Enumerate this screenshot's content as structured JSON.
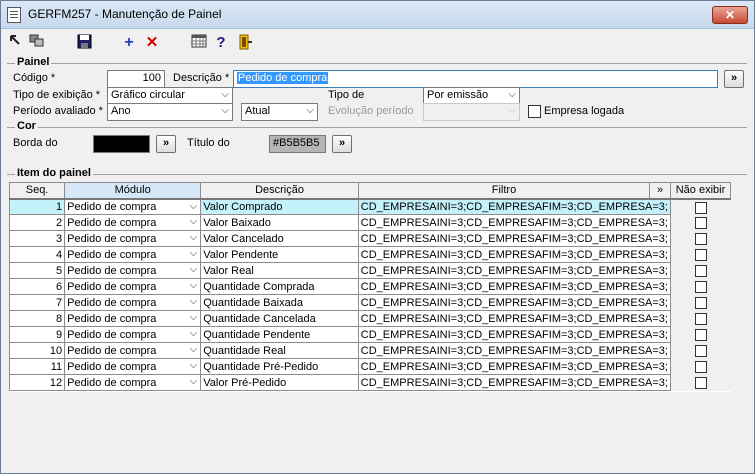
{
  "window": {
    "title": "GERFM257 - Manutenção de Painel",
    "close_glyph": "✕"
  },
  "toolbar": {
    "icons": [
      "expand-icon",
      "windows-icon",
      "save-icon",
      "add-icon",
      "delete-icon",
      "calendar-icon",
      "help-icon",
      "exit-icon"
    ],
    "add_glyph": "+",
    "delete_glyph": "✕",
    "help_glyph": "?"
  },
  "painel": {
    "group_title": "Painel",
    "codigo_label": "Código *",
    "codigo_value": "100",
    "descricao_label": "Descrição *",
    "descricao_value": "Pedido de compra",
    "descricao_button": "»",
    "tipo_exibicao_label": "Tipo de exibição *",
    "tipo_exibicao_value": "Gráfico circular",
    "tipo_de_label": "Tipo de",
    "tipo_de_value": "Por emissão",
    "periodo_label": "Período avaliado *",
    "periodo_value": "Ano",
    "atual_value": "Atual",
    "evolucao_label": "Evolução período",
    "evolucao_value": "",
    "empresa_logada_label": "Empresa logada"
  },
  "cor": {
    "group_title": "Cor",
    "borda_label": "Borda do",
    "borda_color": "#000000",
    "borda_button": "»",
    "titulo_label": "Título do",
    "titulo_value": "#B5B5B5",
    "titulo_button": "»"
  },
  "itens": {
    "group_title": "Item do painel",
    "headers": {
      "seq": "Seq.",
      "modulo": "Módulo",
      "descricao": "Descrição",
      "filtro": "Filtro",
      "more": "»",
      "nao_exibir": "Não exibir"
    },
    "rows": [
      {
        "seq": "1",
        "modulo": "Pedido de compra",
        "descricao": "Valor Comprado",
        "filtro": "CD_EMPRESAINI=3;CD_EMPRESAFIM=3;CD_EMPRESA=3;"
      },
      {
        "seq": "2",
        "modulo": "Pedido de compra",
        "descricao": "Valor Baixado",
        "filtro": "CD_EMPRESAINI=3;CD_EMPRESAFIM=3;CD_EMPRESA=3;"
      },
      {
        "seq": "3",
        "modulo": "Pedido de compra",
        "descricao": "Valor Cancelado",
        "filtro": "CD_EMPRESAINI=3;CD_EMPRESAFIM=3;CD_EMPRESA=3;"
      },
      {
        "seq": "4",
        "modulo": "Pedido de compra",
        "descricao": "Valor Pendente",
        "filtro": "CD_EMPRESAINI=3;CD_EMPRESAFIM=3;CD_EMPRESA=3;"
      },
      {
        "seq": "5",
        "modulo": "Pedido de compra",
        "descricao": "Valor Real",
        "filtro": "CD_EMPRESAINI=3;CD_EMPRESAFIM=3;CD_EMPRESA=3;"
      },
      {
        "seq": "6",
        "modulo": "Pedido de compra",
        "descricao": "Quantidade Comprada",
        "filtro": "CD_EMPRESAINI=3;CD_EMPRESAFIM=3;CD_EMPRESA=3;"
      },
      {
        "seq": "7",
        "modulo": "Pedido de compra",
        "descricao": "Quantidade Baixada",
        "filtro": "CD_EMPRESAINI=3;CD_EMPRESAFIM=3;CD_EMPRESA=3;"
      },
      {
        "seq": "8",
        "modulo": "Pedido de compra",
        "descricao": "Quantidade Cancelada",
        "filtro": "CD_EMPRESAINI=3;CD_EMPRESAFIM=3;CD_EMPRESA=3;"
      },
      {
        "seq": "9",
        "modulo": "Pedido de compra",
        "descricao": "Quantidade Pendente",
        "filtro": "CD_EMPRESAINI=3;CD_EMPRESAFIM=3;CD_EMPRESA=3;"
      },
      {
        "seq": "10",
        "modulo": "Pedido de compra",
        "descricao": "Quantidade Real",
        "filtro": "CD_EMPRESAINI=3;CD_EMPRESAFIM=3;CD_EMPRESA=3;"
      },
      {
        "seq": "11",
        "modulo": "Pedido de compra",
        "descricao": "Quantidade Pré-Pedido",
        "filtro": "CD_EMPRESAINI=3;CD_EMPRESAFIM=3;CD_EMPRESA=3;"
      },
      {
        "seq": "12",
        "modulo": "Pedido de compra",
        "descricao": "Valor Pré-Pedido",
        "filtro": "CD_EMPRESAINI=3;CD_EMPRESAFIM=3;CD_EMPRESA=3;"
      }
    ]
  }
}
